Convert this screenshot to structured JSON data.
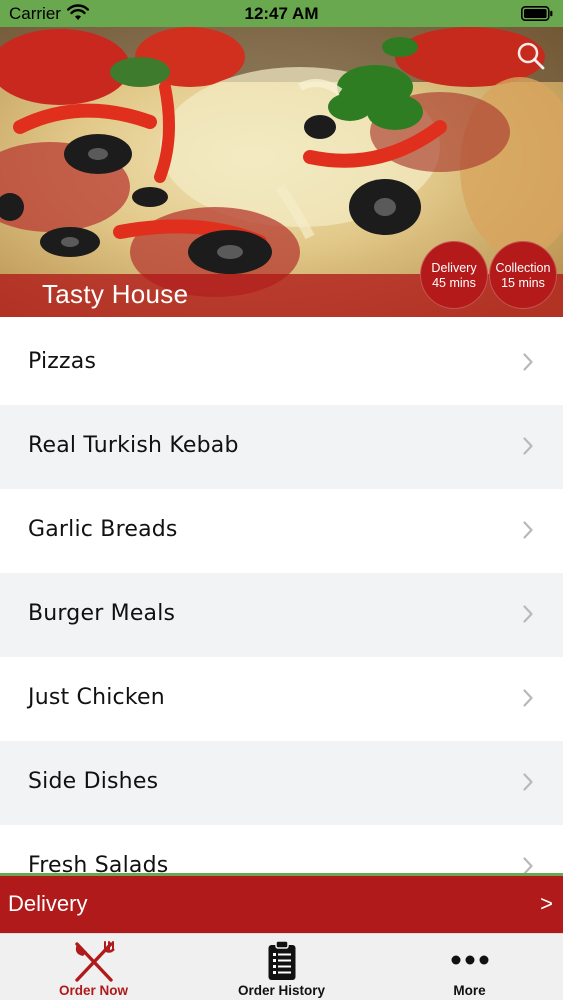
{
  "status_bar": {
    "carrier": "Carrier",
    "time": "12:47 AM"
  },
  "restaurant": {
    "name": "Tasty House",
    "delivery_badge": {
      "line1": "Delivery",
      "line2": "45 mins"
    },
    "collection_badge": {
      "line1": "Collection",
      "line2": "15 mins"
    }
  },
  "menu": {
    "categories": [
      {
        "label": "Pizzas"
      },
      {
        "label": "Real Turkish Kebab"
      },
      {
        "label": "Garlic Breads"
      },
      {
        "label": "Burger Meals"
      },
      {
        "label": "Just Chicken"
      },
      {
        "label": "Side Dishes"
      },
      {
        "label": "Fresh Salads"
      }
    ]
  },
  "order_bar": {
    "mode": "Delivery",
    "arrow": ">"
  },
  "tabs": [
    {
      "label": "Order Now",
      "icon": "fork-knife-icon"
    },
    {
      "label": "Order History",
      "icon": "clipboard-list-icon"
    },
    {
      "label": "More",
      "icon": "more-dots-icon"
    }
  ],
  "colors": {
    "brand_red": "#b01a1a",
    "accent_green": "#6aa84f"
  }
}
